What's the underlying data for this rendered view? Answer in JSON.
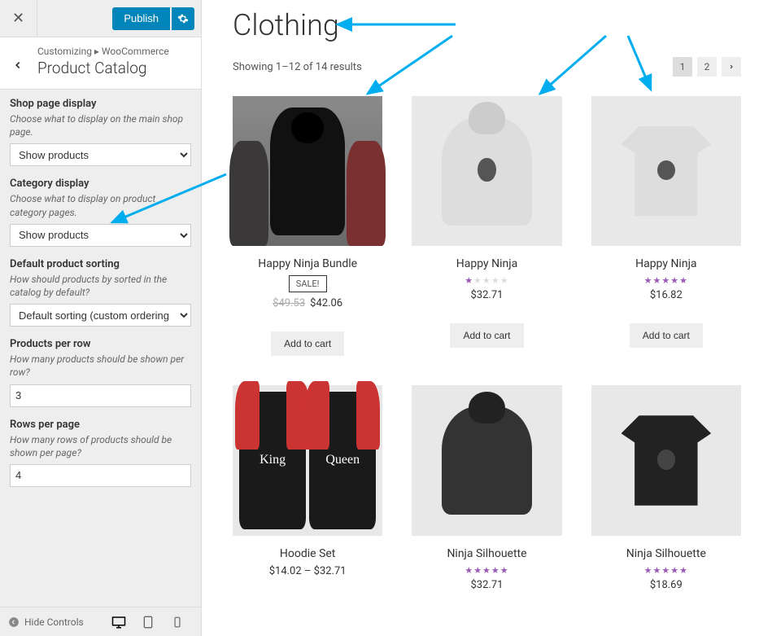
{
  "sidebar": {
    "publish_label": "Publish",
    "breadcrumb": "Customizing ▸ WooCommerce",
    "panel_title": "Product Catalog",
    "hide_controls_label": "Hide Controls",
    "controls": {
      "shop_display": {
        "label": "Shop page display",
        "desc": "Choose what to display on the main shop page.",
        "value": "Show products"
      },
      "category_display": {
        "label": "Category display",
        "desc": "Choose what to display on product category pages.",
        "value": "Show products"
      },
      "default_sorting": {
        "label": "Default product sorting",
        "desc": "How should products by sorted in the catalog by default?",
        "value": "Default sorting (custom ordering + na"
      },
      "products_per_row": {
        "label": "Products per row",
        "desc": "How many products should be shown per row?",
        "value": "3"
      },
      "rows_per_page": {
        "label": "Rows per page",
        "desc": "How many rows of products should be shown per page?",
        "value": "4"
      }
    }
  },
  "shop": {
    "title": "Clothing",
    "result_text": "Showing 1–12 of 14 results",
    "pages": [
      "1",
      "2"
    ],
    "add_to_cart_label": "Add to cart",
    "sale_label": "SALE!",
    "products": [
      {
        "name": "Happy Ninja Bundle",
        "sale": true,
        "old_price": "$49.53",
        "price": "$42.06",
        "rating": 0
      },
      {
        "name": "Happy Ninja",
        "price": "$32.71",
        "rating": 1
      },
      {
        "name": "Happy Ninja",
        "price": "$16.82",
        "rating": 5
      },
      {
        "name": "Hoodie Set",
        "price": "$14.02 – $32.71",
        "rating": 0
      },
      {
        "name": "Ninja Silhouette",
        "price": "$32.71",
        "rating": 5
      },
      {
        "name": "Ninja Silhouette",
        "price": "$18.69",
        "rating": 5
      }
    ]
  },
  "colors": {
    "arrow": "#00aeef",
    "publish": "#0085ba",
    "star": "#9b59b6"
  }
}
